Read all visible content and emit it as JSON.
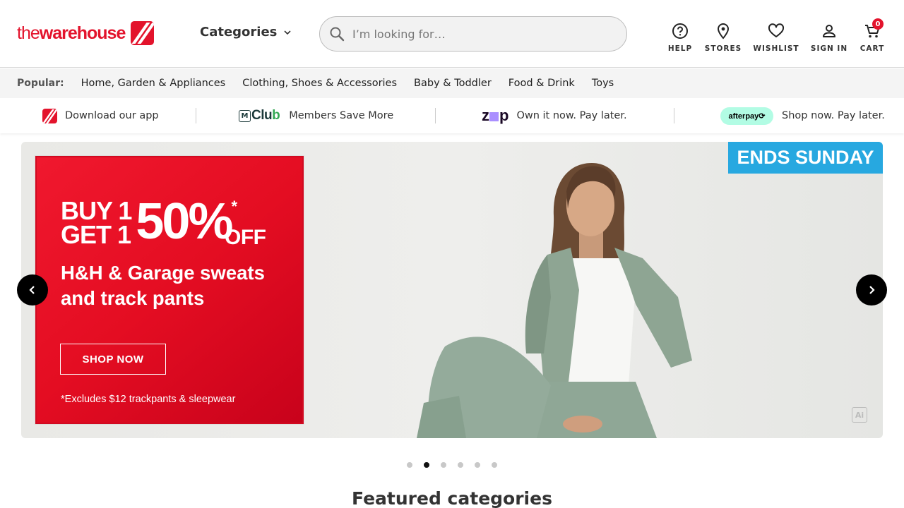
{
  "brand": {
    "name_part1": "the",
    "name_part2": "warehouse",
    "accent": "#e3132c"
  },
  "header": {
    "categories_label": "Categories",
    "search_placeholder": "I’m looking for…",
    "nav": [
      {
        "label": "HELP",
        "icon": "help-icon"
      },
      {
        "label": "STORES",
        "icon": "location-pin-icon"
      },
      {
        "label": "WISHLIST",
        "icon": "heart-icon"
      },
      {
        "label": "SIGN IN",
        "icon": "person-icon"
      },
      {
        "label": "CART",
        "icon": "cart-icon"
      }
    ],
    "cart_count": "0"
  },
  "popular": {
    "label": "Popular:",
    "links": [
      "Home, Garden & Appliances",
      "Clothing, Shoes & Accessories",
      "Baby & Toddler",
      "Food & Drink",
      "Toys"
    ]
  },
  "promo": {
    "app_text": "Download our app",
    "club_logo_m": "M",
    "club_logo_text_a": "Clu",
    "club_logo_text_b": "b",
    "club_text": "Members Save More",
    "zip_logo_a": "z",
    "zip_logo_b": "p",
    "zip_text": "Own it now. Pay later.",
    "afterpay_logo": "afterpay⟳",
    "afterpay_text": "Shop now. Pay later."
  },
  "hero": {
    "ends_label": "ENDS SUNDAY",
    "buy_line1": "BUY 1",
    "buy_line2": "GET 1",
    "percent": "50%",
    "asterisk": "*",
    "off": "OFF",
    "headline": "H&H & Garage sweats and track pants",
    "cta": "SHOP NOW",
    "disclaimer": "*Excludes $12 trackpants & sleepwear",
    "ai_badge": "Ai",
    "colors": {
      "badge": "#27a8e0",
      "panel": "#e40d22"
    }
  },
  "carousel": {
    "slides": 6,
    "active_index": 1
  },
  "featured_title": "Featured categories"
}
